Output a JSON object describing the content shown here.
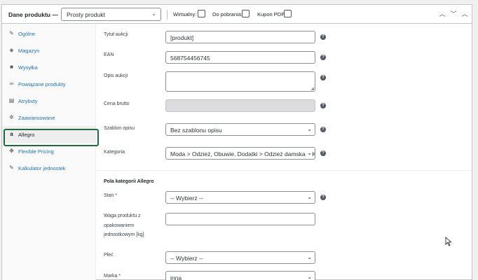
{
  "header": {
    "title": "Dane produktu —",
    "product_type": "Prosty produkt",
    "options": [
      {
        "label": "Wirtualny:",
        "checked": false
      },
      {
        "label": "Do pobrania:",
        "checked": false
      },
      {
        "label": "Kupon PDF:",
        "checked": false
      }
    ],
    "buttons": [
      "▲",
      "▼",
      "▲"
    ]
  },
  "sidebar": {
    "items": [
      {
        "label": "Ogólne",
        "icon": "wrench-icon"
      },
      {
        "label": "Magazyn",
        "icon": "tag-icon"
      },
      {
        "label": "Wysyłka",
        "icon": "truck-icon"
      },
      {
        "label": "Powiązane produkty",
        "icon": "link-icon"
      },
      {
        "label": "Atrybuty",
        "icon": "table-icon"
      },
      {
        "label": "Zaawansowane",
        "icon": "gear-icon"
      },
      {
        "label": "Allegro",
        "icon": "allegro-a-icon",
        "active": true
      },
      {
        "label": "Flexible Pricing",
        "icon": "move-icon"
      },
      {
        "label": "Kalkulator jednostek",
        "icon": "wrench-icon"
      }
    ]
  },
  "fields": {
    "title": {
      "label": "Tytuł aukcji",
      "value": "[produkt]"
    },
    "ean": {
      "label": "EAN",
      "value": "568754456745"
    },
    "description": {
      "label": "Opis aukcji",
      "value": ""
    },
    "gross_price": {
      "label": "Cena brutto",
      "value": ""
    },
    "template": {
      "label": "Szablon opisu",
      "value": "Bez szablonu opisu"
    },
    "category": {
      "label": "Kategoria",
      "value": "Moda > Odzież, Obuwie, Dodatki > Odzież damska > Ko"
    }
  },
  "category_fields": {
    "heading": "Pola kategorii Allegro",
    "condition": {
      "label": "Stan *",
      "value": "-- Wybierz --"
    },
    "weight": {
      "label": "Waga produktu z opakowaniem jednostkowym [kg]",
      "value": ""
    },
    "gender": {
      "label": "Płeć",
      "value": "-- Wybierz --"
    },
    "brand": {
      "label": "Marka *",
      "value": "inna"
    }
  },
  "icons": {
    "help": "?",
    "chevron": "⌄"
  },
  "colors": {
    "highlight": "#1f6a3a",
    "link": "#2271b1"
  }
}
